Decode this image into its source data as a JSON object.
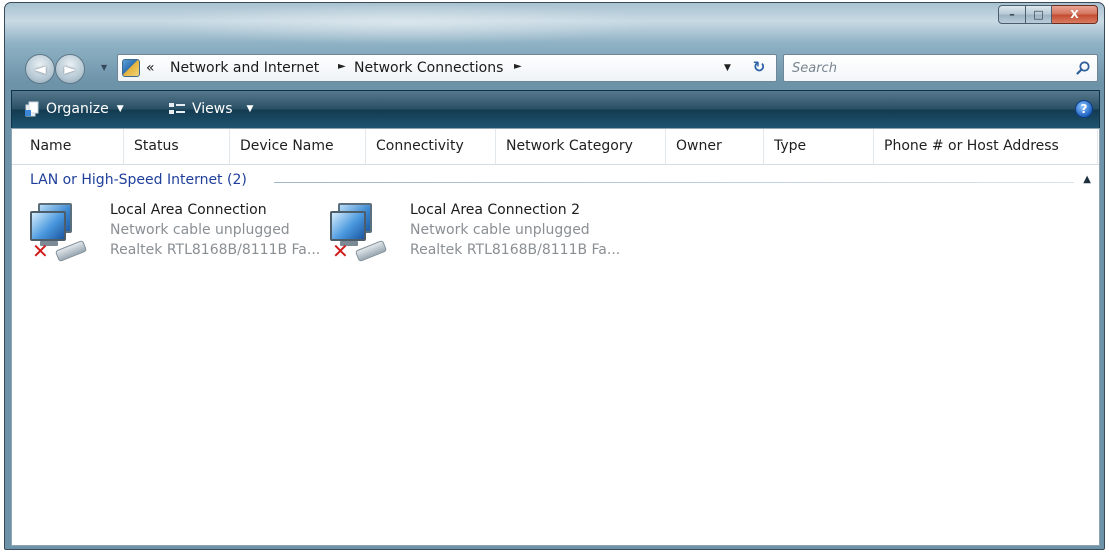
{
  "window": {
    "controls": {
      "minimize": "–",
      "maximize": "□",
      "close": "X"
    }
  },
  "nav": {
    "back_glyph": "◄",
    "forward_glyph": "►",
    "recent_pages_glyph": "▼"
  },
  "address": {
    "overflow_chevron": "«",
    "crumbs": [
      "Network and Internet",
      "Network Connections"
    ],
    "separator": "►",
    "dropdown_glyph": "▼",
    "refresh_glyph": "↻"
  },
  "search": {
    "placeholder": "Search"
  },
  "toolbar": {
    "organize_label": "Organize",
    "views_label": "Views",
    "caret": "▼",
    "help_glyph": "?"
  },
  "columns": [
    {
      "label": "Name"
    },
    {
      "label": "Status"
    },
    {
      "label": "Device Name"
    },
    {
      "label": "Connectivity"
    },
    {
      "label": "Network Category"
    },
    {
      "label": "Owner"
    },
    {
      "label": "Type"
    },
    {
      "label": "Phone # or Host Address"
    }
  ],
  "group": {
    "label": "LAN or High-Speed Internet (2)",
    "collapse_glyph": "▲"
  },
  "items": [
    {
      "title": "Local Area Connection",
      "status": "Network cable unplugged",
      "device": "Realtek RTL8168B/8111B Fa...",
      "error_glyph": "✕"
    },
    {
      "title": "Local Area Connection 2",
      "status": "Network cable unplugged",
      "device": "Realtek RTL8168B/8111B Fa...",
      "error_glyph": "✕"
    }
  ],
  "colors": {
    "group_header": "#1f3f9a",
    "toolbar_dark": "#133b52",
    "error_red": "#d11a1a",
    "muted_text": "#8a8f94"
  }
}
